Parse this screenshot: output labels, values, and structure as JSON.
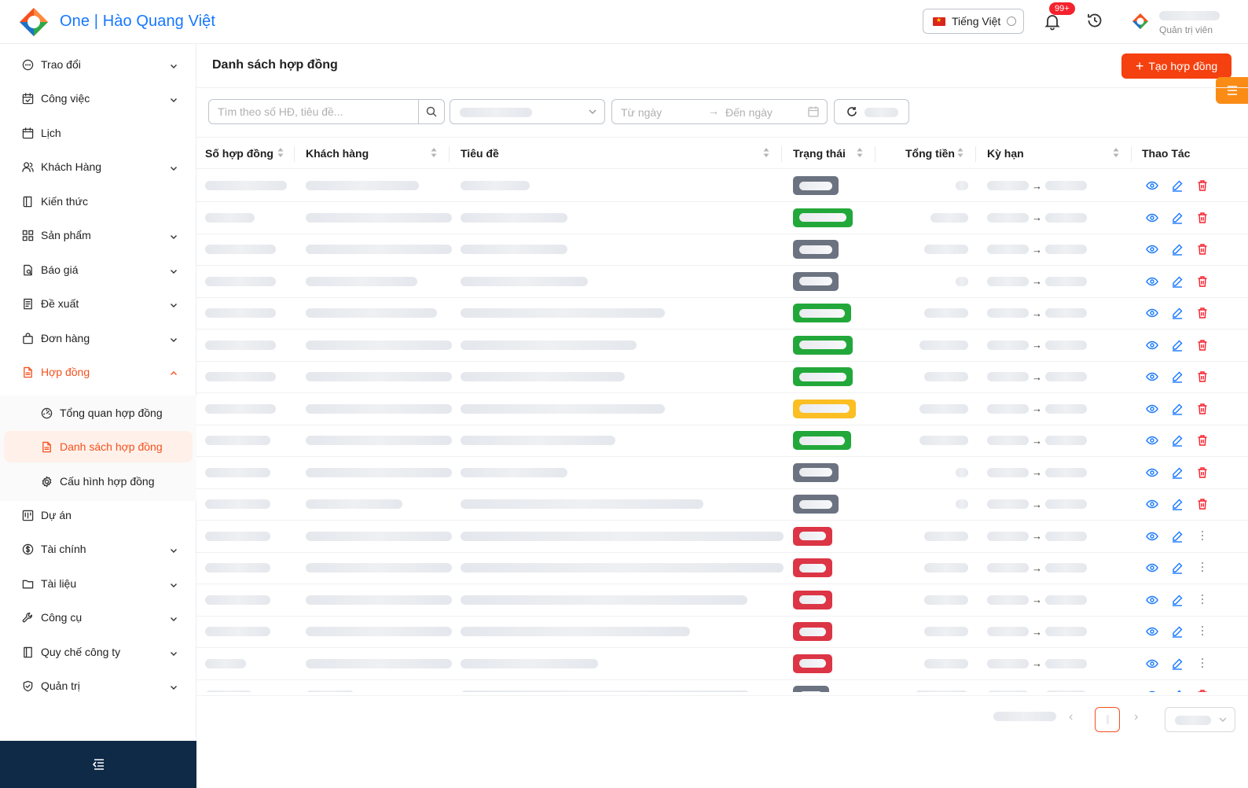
{
  "header": {
    "app_title": "One | Hào Quang Việt",
    "language": "Tiếng Việt",
    "notification_count": "99+",
    "user_role": "Quản trị viên"
  },
  "sidebar": {
    "items": [
      {
        "label": "Trao đổi",
        "icon": "chat-icon",
        "expandable": true
      },
      {
        "label": "Công việc",
        "icon": "calendar-check-icon",
        "expandable": true
      },
      {
        "label": "Lịch",
        "icon": "calendar-icon",
        "expandable": false
      },
      {
        "label": "Khách Hàng",
        "icon": "users-icon",
        "expandable": true
      },
      {
        "label": "Kiến thức",
        "icon": "book-icon",
        "expandable": false
      },
      {
        "label": "Sản phẩm",
        "icon": "grid-icon",
        "expandable": true
      },
      {
        "label": "Báo giá",
        "icon": "quote-icon",
        "expandable": true
      },
      {
        "label": "Đề xuất",
        "icon": "proposal-icon",
        "expandable": true
      },
      {
        "label": "Đơn hàng",
        "icon": "bag-icon",
        "expandable": true
      },
      {
        "label": "Hợp đồng",
        "icon": "contract-icon",
        "expandable": true,
        "active": true
      }
    ],
    "submenu": [
      {
        "label": "Tổng quan hợp đồng",
        "icon": "dashboard-icon"
      },
      {
        "label": "Danh sách hợp đồng",
        "icon": "file-list-icon",
        "selected": true
      },
      {
        "label": "Cấu hình hợp đồng",
        "icon": "settings-icon"
      }
    ],
    "items_after": [
      {
        "label": "Dự án",
        "icon": "project-icon",
        "expandable": false
      },
      {
        "label": "Tài chính",
        "icon": "dollar-icon",
        "expandable": true
      },
      {
        "label": "Tài liệu",
        "icon": "folder-icon",
        "expandable": true
      },
      {
        "label": "Công cụ",
        "icon": "tool-icon",
        "expandable": true
      },
      {
        "label": "Quy chế công ty",
        "icon": "rules-icon",
        "expandable": true
      },
      {
        "label": "Quản trị",
        "icon": "shield-icon",
        "expandable": true
      }
    ]
  },
  "main": {
    "page_title": "Danh sách hợp đồng",
    "create_button": "Tạo hợp đồng",
    "search_placeholder": "Tìm theo số HĐ, tiêu đề...",
    "date_from_placeholder": "Từ ngày",
    "date_to_placeholder": "Đến ngày",
    "columns": [
      "Số hợp đồng",
      "Khách hàng",
      "Tiêu đề",
      "Trạng thái",
      "Tổng tiền",
      "Kỳ hạn",
      "Thao Tác"
    ],
    "status_colors": {
      "gray": "#6b7280",
      "green": "#22a83a",
      "yellow": "#fbbf24",
      "red": "#dc3545"
    },
    "rows": [
      {
        "status": "gray",
        "actions": "delete"
      },
      {
        "status": "green",
        "actions": "delete"
      },
      {
        "status": "gray",
        "actions": "delete"
      },
      {
        "status": "gray",
        "actions": "delete"
      },
      {
        "status": "green",
        "actions": "delete"
      },
      {
        "status": "green",
        "actions": "delete"
      },
      {
        "status": "green",
        "actions": "delete"
      },
      {
        "status": "yellow",
        "actions": "delete"
      },
      {
        "status": "green",
        "actions": "delete"
      },
      {
        "status": "gray",
        "actions": "delete"
      },
      {
        "status": "gray",
        "actions": "delete"
      },
      {
        "status": "red",
        "actions": "more"
      },
      {
        "status": "red",
        "actions": "more"
      },
      {
        "status": "red",
        "actions": "more"
      },
      {
        "status": "red",
        "actions": "more"
      },
      {
        "status": "red",
        "actions": "more"
      },
      {
        "status": "gray",
        "actions": "delete"
      }
    ],
    "range_arrow": "→"
  },
  "accent_color": "#f5511e"
}
